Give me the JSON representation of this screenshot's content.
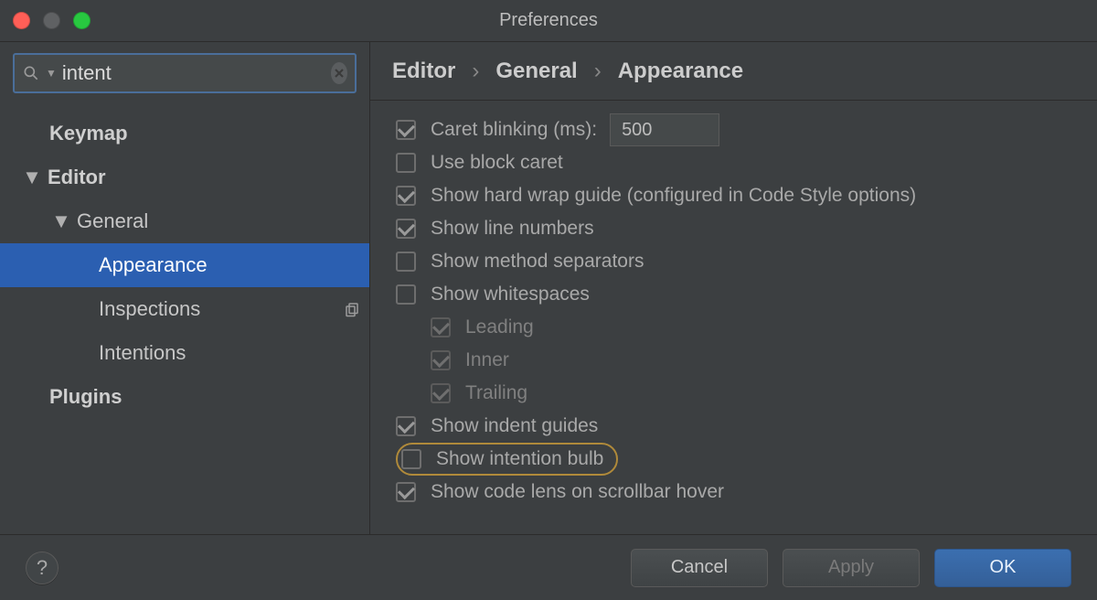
{
  "window": {
    "title": "Preferences"
  },
  "search": {
    "value": "intent",
    "placeholder": ""
  },
  "sidebar": {
    "items": [
      {
        "label": "Keymap",
        "level": "lvl0",
        "bold": true,
        "arrow": "",
        "selected": false,
        "hasBadge": false
      },
      {
        "label": "Editor",
        "level": "lvl0a",
        "bold": true,
        "arrow": "▼",
        "selected": false,
        "hasBadge": false
      },
      {
        "label": "General",
        "level": "lvl1",
        "bold": false,
        "arrow": "▼",
        "selected": false,
        "hasBadge": false
      },
      {
        "label": "Appearance",
        "level": "lvl2",
        "bold": false,
        "arrow": "",
        "selected": true,
        "hasBadge": false
      },
      {
        "label": "Inspections",
        "level": "lvl2",
        "bold": false,
        "arrow": "",
        "selected": false,
        "hasBadge": true
      },
      {
        "label": "Intentions",
        "level": "lvl2",
        "bold": false,
        "arrow": "",
        "selected": false,
        "hasBadge": false
      },
      {
        "label": "Plugins",
        "level": "lvl0",
        "bold": true,
        "arrow": "",
        "selected": false,
        "hasBadge": false
      }
    ]
  },
  "breadcrumb": {
    "a": "Editor",
    "b": "General",
    "c": "Appearance",
    "sep": "›"
  },
  "options": [
    {
      "label": "Caret blinking (ms):",
      "checked": true,
      "disabled": false,
      "indent": 0,
      "input": "500",
      "highlight": false
    },
    {
      "label": "Use block caret",
      "checked": false,
      "disabled": false,
      "indent": 0,
      "highlight": false
    },
    {
      "label": "Show hard wrap guide (configured in Code Style options)",
      "checked": true,
      "disabled": false,
      "indent": 0,
      "highlight": false
    },
    {
      "label": "Show line numbers",
      "checked": true,
      "disabled": false,
      "indent": 0,
      "highlight": false
    },
    {
      "label": "Show method separators",
      "checked": false,
      "disabled": false,
      "indent": 0,
      "highlight": false
    },
    {
      "label": "Show whitespaces",
      "checked": false,
      "disabled": false,
      "indent": 0,
      "highlight": false
    },
    {
      "label": "Leading",
      "checked": true,
      "disabled": true,
      "indent": 1,
      "highlight": false
    },
    {
      "label": "Inner",
      "checked": true,
      "disabled": true,
      "indent": 1,
      "highlight": false
    },
    {
      "label": "Trailing",
      "checked": true,
      "disabled": true,
      "indent": 1,
      "highlight": false
    },
    {
      "label": "Show indent guides",
      "checked": true,
      "disabled": false,
      "indent": 0,
      "highlight": false
    },
    {
      "label": "Show intention bulb",
      "checked": false,
      "disabled": false,
      "indent": 0,
      "highlight": true
    },
    {
      "label": "Show code lens on scrollbar hover",
      "checked": true,
      "disabled": false,
      "indent": 0,
      "highlight": false
    }
  ],
  "footer": {
    "help": "?",
    "cancel": "Cancel",
    "apply": "Apply",
    "ok": "OK"
  }
}
